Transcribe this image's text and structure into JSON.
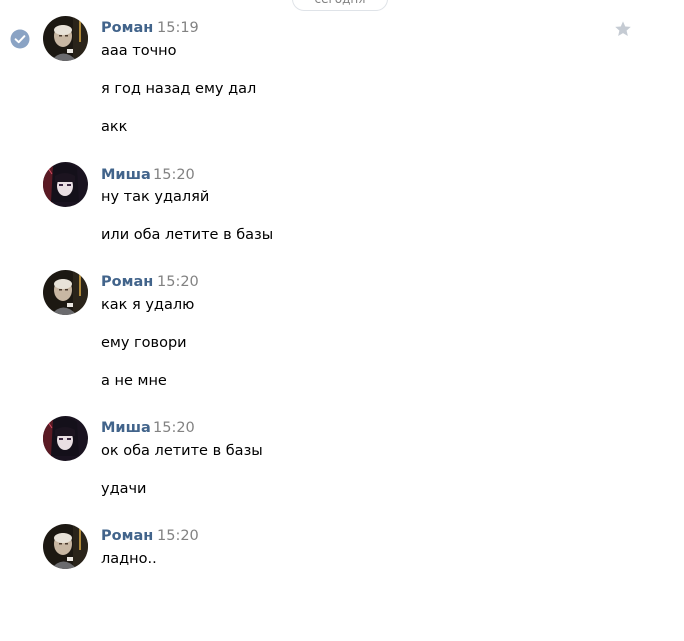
{
  "date_divider": "сегодня",
  "messages": [
    {
      "author": "Роман",
      "time": "15:19",
      "lines": [
        "ааа точно",
        "я год назад ему дал",
        "акк"
      ]
    },
    {
      "author": "Миша",
      "time": "15:20",
      "lines": [
        "ну так удаляй",
        "или оба летите в базы"
      ]
    },
    {
      "author": "Роман",
      "time": "15:20",
      "lines": [
        "как я удалю",
        "ему говори",
        "а не мне"
      ]
    },
    {
      "author": "Миша",
      "time": "15:20",
      "lines": [
        "ок оба летите в базы",
        "удачи"
      ]
    },
    {
      "author": "Роман",
      "time": "15:20",
      "lines": [
        "ладно.."
      ]
    }
  ],
  "colors": {
    "author": "#42648b",
    "time": "#828282",
    "check": "#8aa3c4",
    "star": "#c5cbd3"
  },
  "icons": {
    "selected": "check-circle-icon",
    "favorite": "star-icon"
  }
}
